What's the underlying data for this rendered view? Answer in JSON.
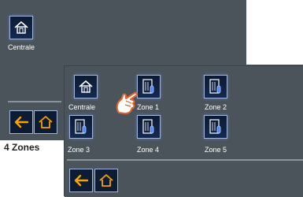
{
  "back_screen": {
    "tile": {
      "label": "Centrale",
      "icon": "house-icon"
    },
    "nav": {
      "back_icon": "arrow-left-icon",
      "home_icon": "home-icon"
    }
  },
  "front_screen": {
    "tiles": [
      {
        "label": "Centrale",
        "icon": "house-icon"
      },
      {
        "label": "Zone 1",
        "icon": "zone-door-icon"
      },
      {
        "label": "Zone 2",
        "icon": "zone-door-icon"
      },
      {
        "label": "Zone 3",
        "icon": "zone-door-icon"
      },
      {
        "label": "Zone 4",
        "icon": "zone-door-icon"
      },
      {
        "label": "Zone 5",
        "icon": "zone-door-icon"
      }
    ],
    "nav": {
      "back_icon": "arrow-left-icon",
      "home_icon": "home-icon"
    }
  },
  "caption": "4 Zones",
  "colors": {
    "panel": "#4b545b",
    "accent_orange": "#f5a400",
    "icon_border": "#9fb6de"
  }
}
